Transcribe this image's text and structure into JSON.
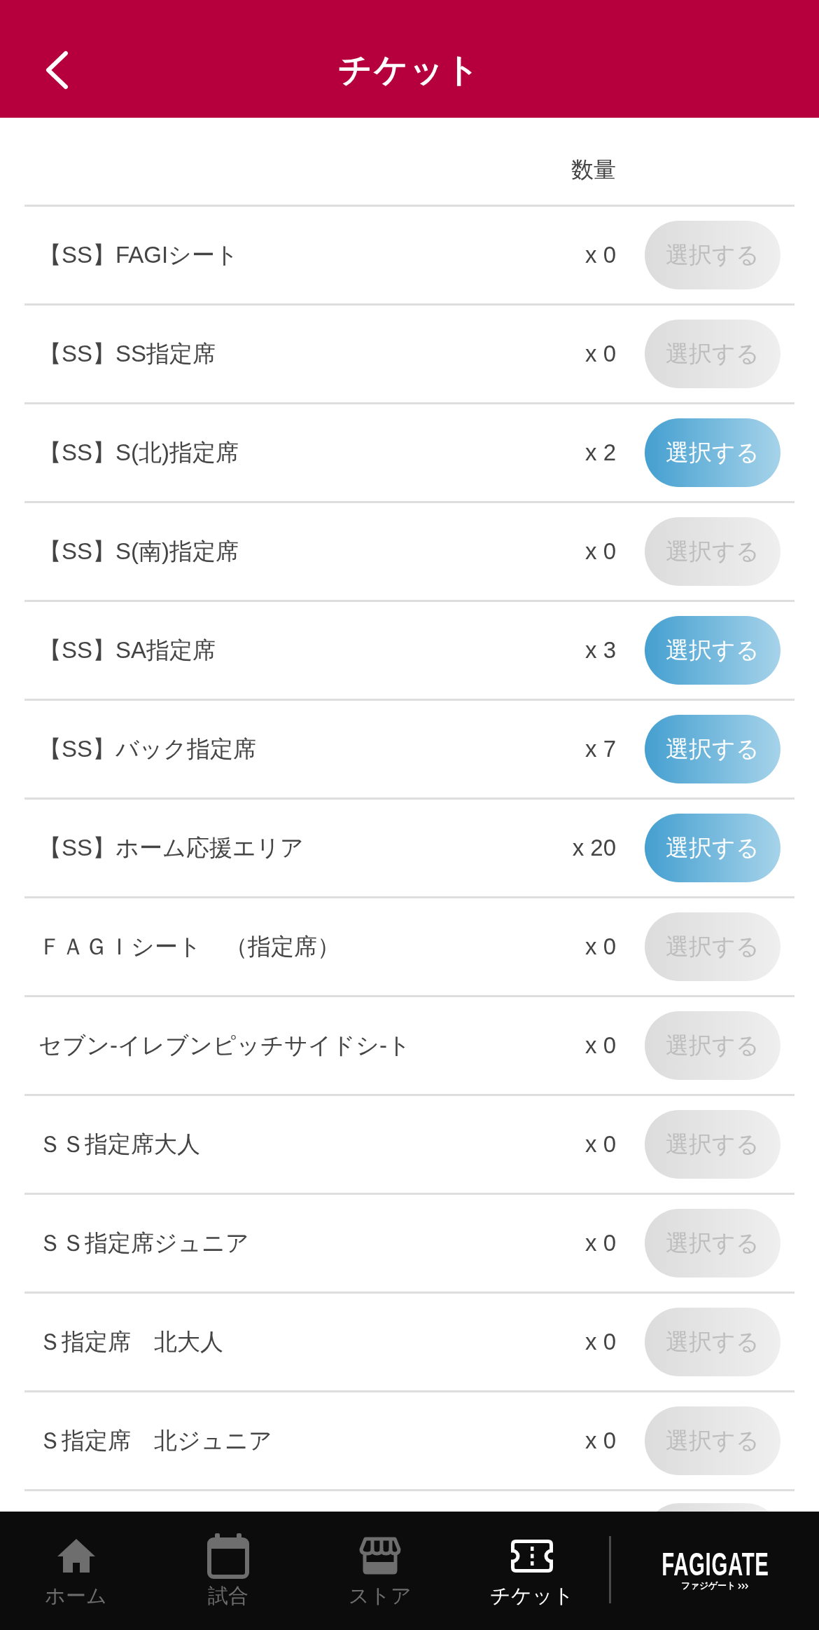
{
  "header": {
    "title": "チケット"
  },
  "table": {
    "quantity_heading": "数量",
    "rows": [
      {
        "name": "【SS】FAGIシート",
        "quantity": "x 0",
        "button": "選択する",
        "disabled": true
      },
      {
        "name": "【SS】SS指定席",
        "quantity": "x 0",
        "button": "選択する",
        "disabled": true
      },
      {
        "name": "【SS】S(北)指定席",
        "quantity": "x 2",
        "button": "選択する",
        "disabled": false
      },
      {
        "name": "【SS】S(南)指定席",
        "quantity": "x 0",
        "button": "選択する",
        "disabled": true
      },
      {
        "name": "【SS】SA指定席",
        "quantity": "x 3",
        "button": "選択する",
        "disabled": false
      },
      {
        "name": "【SS】バック指定席",
        "quantity": "x 7",
        "button": "選択する",
        "disabled": false
      },
      {
        "name": "【SS】ホーム応援エリア",
        "quantity": "x 20",
        "button": "選択する",
        "disabled": false
      },
      {
        "name": "ＦＡＧＩシート　（指定席）",
        "quantity": "x 0",
        "button": "選択する",
        "disabled": true
      },
      {
        "name": "セブン-イレブンピッチサイドシ-ト",
        "quantity": "x 0",
        "button": "選択する",
        "disabled": true
      },
      {
        "name": "ＳＳ指定席大人",
        "quantity": "x 0",
        "button": "選択する",
        "disabled": true
      },
      {
        "name": "ＳＳ指定席ジュニア",
        "quantity": "x 0",
        "button": "選択する",
        "disabled": true
      },
      {
        "name": "Ｓ指定席　北大人",
        "quantity": "x 0",
        "button": "選択する",
        "disabled": true
      },
      {
        "name": "Ｓ指定席　北ジュニア",
        "quantity": "x 0",
        "button": "選択する",
        "disabled": true
      }
    ],
    "cut_off_row": {
      "disabled": true
    }
  },
  "nav": {
    "items": [
      {
        "label": "ホーム",
        "selected": false
      },
      {
        "label": "試合",
        "selected": false
      },
      {
        "label": "ストア",
        "selected": false
      },
      {
        "label": "チケット",
        "selected": true
      }
    ],
    "logo": {
      "wordmark": "FAGIGATE",
      "subtitle": "ファジゲート"
    }
  }
}
